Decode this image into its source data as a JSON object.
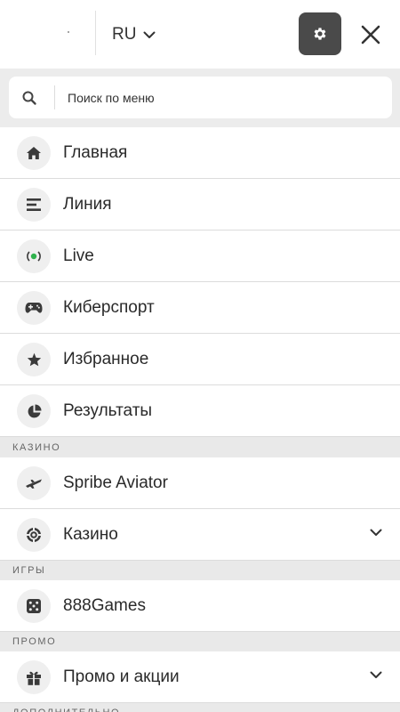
{
  "header": {
    "language": "RU"
  },
  "search": {
    "placeholder": "Поиск по меню"
  },
  "menu": {
    "main_items": [
      {
        "label": "Главная",
        "icon": "home-icon"
      },
      {
        "label": "Линия",
        "icon": "list-lines-icon"
      },
      {
        "label": "Live",
        "icon": "live-signal-icon"
      },
      {
        "label": "Киберспорт",
        "icon": "gamepad-icon"
      },
      {
        "label": "Избранное",
        "icon": "star-icon"
      },
      {
        "label": "Результаты",
        "icon": "pie-chart-icon"
      }
    ],
    "casino_section": {
      "title": "КАЗИНО",
      "items": [
        {
          "label": "Spribe Aviator",
          "icon": "airplane-icon"
        },
        {
          "label": "Казино",
          "icon": "casino-chip-icon",
          "expandable": true
        }
      ]
    },
    "games_section": {
      "title": "ИГРЫ",
      "items": [
        {
          "label": "888Games",
          "icon": "dice-icon"
        }
      ]
    },
    "promo_section": {
      "title": "ПРОМО",
      "items": [
        {
          "label": "Промо и акции",
          "icon": "gift-icon",
          "expandable": true
        }
      ]
    },
    "extra_section": {
      "title": "ДОПОЛНИТЕЛЬНО"
    }
  },
  "colors": {
    "settings_button": "#4a4a4a",
    "live_accent": "#2fb24c",
    "section_bg": "#e9e9e9",
    "icon_circle_bg": "#efefef"
  }
}
